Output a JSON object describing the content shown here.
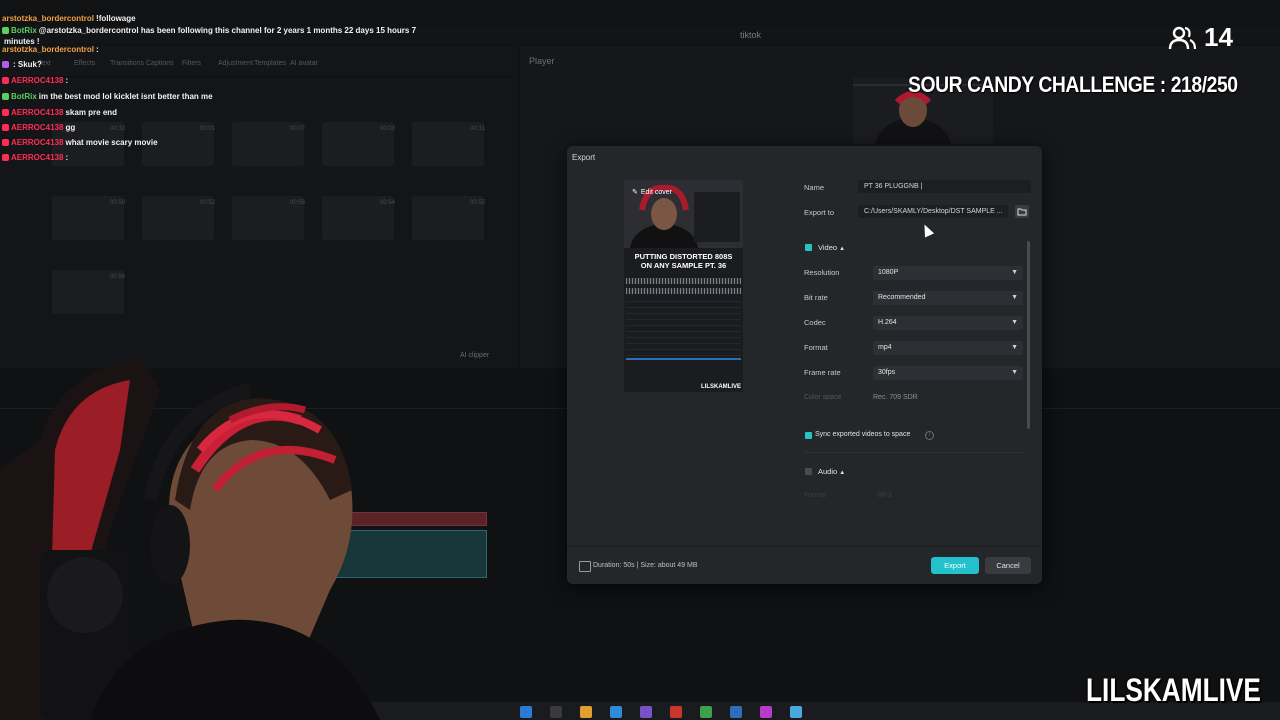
{
  "app": {
    "title": "tiktok",
    "player_label": "Player"
  },
  "toolbar": [
    "Text",
    "Effects",
    "Transitions",
    "Captions",
    "Filters",
    "Adjustment",
    "Templates",
    "AI avatar"
  ],
  "media": {
    "thumbs": [
      {
        "time": "00:32"
      },
      {
        "time": "00:01"
      },
      {
        "time": "00:07"
      },
      {
        "time": "00:03"
      },
      {
        "time": "00:31"
      },
      {
        "time": "00:50"
      },
      {
        "time": "00:52"
      },
      {
        "time": "00:56"
      },
      {
        "time": "00:54"
      },
      {
        "time": "00:55"
      },
      {
        "time": "00:56"
      }
    ],
    "ai_clipper": "AI clipper"
  },
  "chat": [
    {
      "user": "arstotzka_bordercontrol",
      "user_color": "#f0a040",
      "msg": "!followage",
      "badge": false
    },
    {
      "user": "BotRix",
      "user_color": "#5bd05b",
      "msg": "@arstotzka_bordercontrol has been following this channel for 2 years 1 months 22 days 15 hours 7",
      "badge": true
    },
    {
      "user": "",
      "user_color": "#ffffff",
      "msg": "minutes !",
      "badge": false
    },
    {
      "user": "arstotzka_bordercontrol",
      "user_color": "#f0a040",
      "msg": ":",
      "badge": false
    },
    {
      "user": "",
      "user_color": "#b45cf0",
      "msg": ": Skuk?",
      "badge": true
    },
    {
      "user": "AERROC4138",
      "user_color": "#ff2d55",
      "msg": ":",
      "badge": true
    },
    {
      "user": "BotRix",
      "user_color": "#5bd05b",
      "msg": "im the best mod lol kicklet isnt better than me",
      "badge": true
    },
    {
      "user": "AERROC4138",
      "user_color": "#ff2d55",
      "msg": "skam pre end",
      "badge": true
    },
    {
      "user": "AERROC4138",
      "user_color": "#ff2d55",
      "msg": "gg",
      "badge": true
    },
    {
      "user": "AERROC4138",
      "user_color": "#ff2d55",
      "msg": "what movie scary movie",
      "badge": true
    },
    {
      "user": "AERROC4138",
      "user_color": "#ff2d55",
      "msg": ":",
      "badge": true
    }
  ],
  "overlay": {
    "viewer_count": "14",
    "challenge": "SOUR CANDY CHALLENGE : 218/250",
    "brand": "LILSKAMLIVE"
  },
  "export": {
    "title": "Export",
    "cover": {
      "edit_label": "Edit cover",
      "caption_line1": "PUTTING DISTORTED 808S",
      "caption_line2": "ON ANY SAMPLE PT. 36",
      "brand": "LILSKAMLIVE"
    },
    "name_label": "Name",
    "name_value": "PT 36 PLUGGNB |",
    "export_to_label": "Export to",
    "export_to_value": "C:/Users/SKAMLY/Desktop/DST SAMPLE ...",
    "video_section": "Video",
    "resolution_label": "Resolution",
    "resolution_value": "1080P",
    "bitrate_label": "Bit rate",
    "bitrate_value": "Recommended",
    "codec_label": "Codec",
    "codec_value": "H.264",
    "format_label": "Format",
    "format_value": "mp4",
    "framerate_label": "Frame rate",
    "framerate_value": "30fps",
    "colorspace_label": "Color space",
    "colorspace_value": "Rec. 709 SDR",
    "sync_label": "Sync exported videos to space",
    "audio_section": "Audio",
    "audio_format_label": "Format",
    "audio_format_value": "MP3",
    "footer": "Duration: 50s | Size: about 49 MB",
    "export_button": "Export",
    "cancel_button": "Cancel"
  },
  "colors": {
    "accent": "#22c1cb",
    "dialog_bg": "#25262a"
  }
}
